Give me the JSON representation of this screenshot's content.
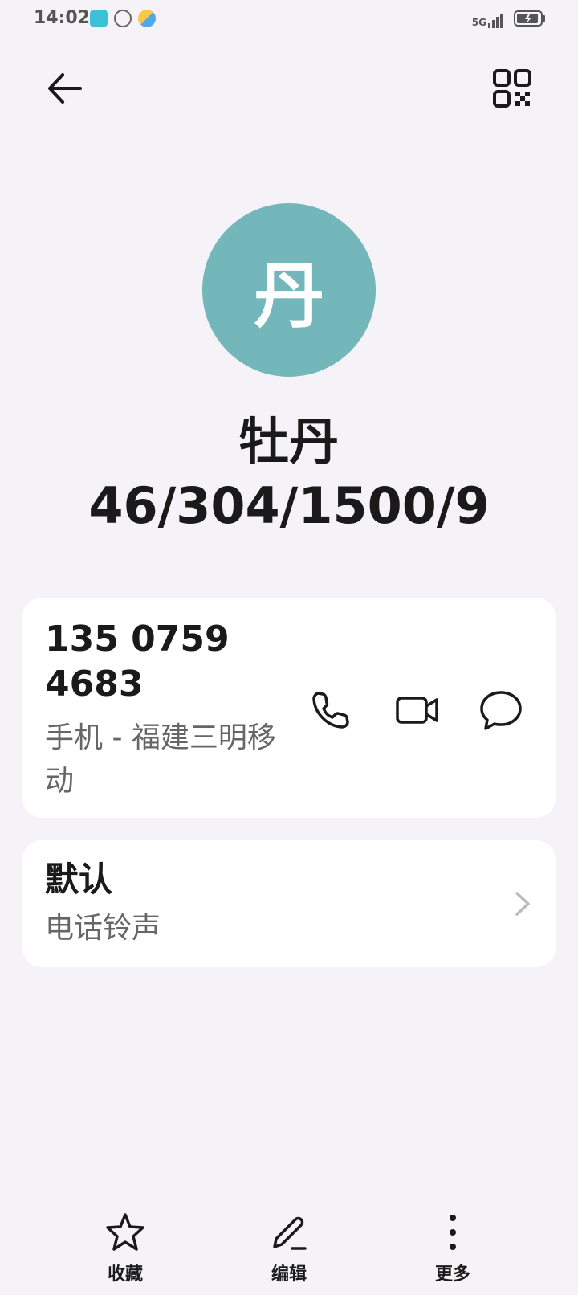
{
  "status": {
    "time": "14:02",
    "network": "5G"
  },
  "contact": {
    "avatar_char": "丹",
    "name": "牡丹",
    "subtitle": "46/304/1500/9"
  },
  "phone": {
    "number": "135 0759 4683",
    "label": "手机 - 福建三明移动"
  },
  "ringtone": {
    "title": "默认",
    "subtitle": "电话铃声"
  },
  "bottom_bar": {
    "favorite": "收藏",
    "edit": "编辑",
    "more": "更多"
  },
  "colors": {
    "avatar": "#74b7ba",
    "background": "#f5f3f7",
    "card": "#ffffff"
  }
}
